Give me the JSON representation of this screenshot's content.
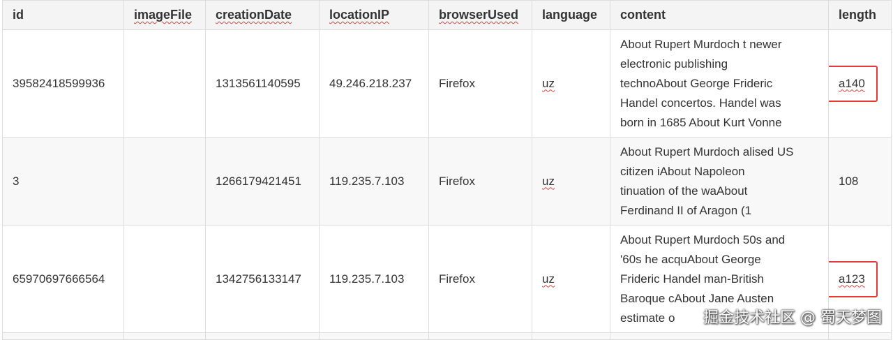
{
  "headers": [
    "id",
    "imageFile",
    "creationDate",
    "locationIP",
    "browserUsed",
    "language",
    "content",
    "length"
  ],
  "rows": [
    {
      "id": "39582418599936",
      "imageFile": "",
      "creationDate": "1313561140595",
      "locationIP": "49.246.218.237",
      "browserUsed": "Firefox",
      "language": "uz",
      "content": [
        [
          "About Rupert Murdoch  t newer"
        ],
        [
          "electronic publishing"
        ],
        [
          "technoAbout George Frideric"
        ],
        [
          "Handel  concertos. Handel was"
        ],
        [
          "born in 1685 About Kurt Vonne"
        ]
      ],
      "length": "a140",
      "length_highlighted": true
    },
    {
      "id": "3",
      "imageFile": "",
      "creationDate": "1266179421451",
      "locationIP": "119.235.7.103",
      "browserUsed": "Firefox",
      "language": "uz",
      "content": [
        [
          "About Rupert Murdoch  alised US"
        ],
        [
          "citizen iAbout Napoleon"
        ],
        [
          "tinuation of the waAbout"
        ],
        [
          "Ferdinand II of Aragon  (1"
        ]
      ],
      "length": "108",
      "length_highlighted": false
    },
    {
      "id": "65970697666564",
      "imageFile": "",
      "creationDate": "1342756133147",
      "locationIP": "119.235.7.103",
      "browserUsed": "Firefox",
      "language": "uz",
      "content": [
        [
          "About Rupert Murdoch  50s and"
        ],
        [
          "'60s  he acquAbout George"
        ],
        [
          "Frideric Handel  man-British"
        ],
        [
          "Baroque cAbout Jane Austen"
        ],
        [
          "estimate o"
        ]
      ],
      "length": "a123",
      "length_highlighted": true
    }
  ],
  "watermark": "掘金技术社区 @ 蜀天梦图",
  "colors": {
    "highlight_border": "#e53935",
    "header_bg": "#f4f4f4",
    "grid_line": "#dddddd"
  }
}
